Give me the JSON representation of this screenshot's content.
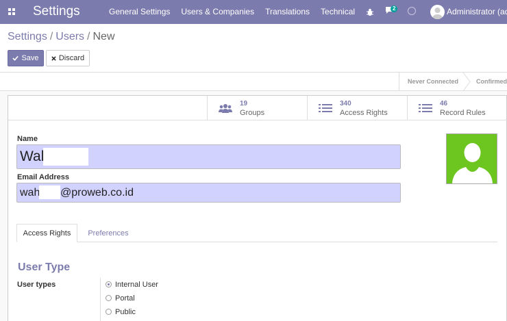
{
  "navbar": {
    "brand": "Settings",
    "menu": [
      "General Settings",
      "Users & Companies",
      "Translations",
      "Technical"
    ],
    "chat_badge": "2",
    "user": "Administrator (adm"
  },
  "breadcrumb": {
    "part1": "Settings",
    "sep": "/",
    "part2": "Users",
    "part3": "New"
  },
  "buttons": {
    "save": "Save",
    "discard": "Discard"
  },
  "statusbar": {
    "never_connected": "Never Connected",
    "confirmed": "Confirmed"
  },
  "stats": [
    {
      "value": "19",
      "label": "Groups",
      "icon": "users-icon"
    },
    {
      "value": "340",
      "label": "Access Rights",
      "icon": "list-icon"
    },
    {
      "value": "46",
      "label": "Record Rules",
      "icon": "list-icon"
    }
  ],
  "form": {
    "name_label": "Name",
    "name_value": "Wal",
    "email_label": "Email Address",
    "email_prefix": "wah",
    "email_suffix": "@proweb.co.id"
  },
  "tabs": {
    "access_rights": "Access Rights",
    "preferences": "Preferences"
  },
  "user_type": {
    "section_title": "User Type",
    "label": "User types",
    "options": [
      "Internal User",
      "Portal",
      "Public"
    ],
    "selected": "Internal User"
  },
  "colors": {
    "brand": "#7c7bad",
    "field_bg": "#d2d2ff",
    "photo_bg": "#6cc61f",
    "badge": "#00a09d"
  }
}
